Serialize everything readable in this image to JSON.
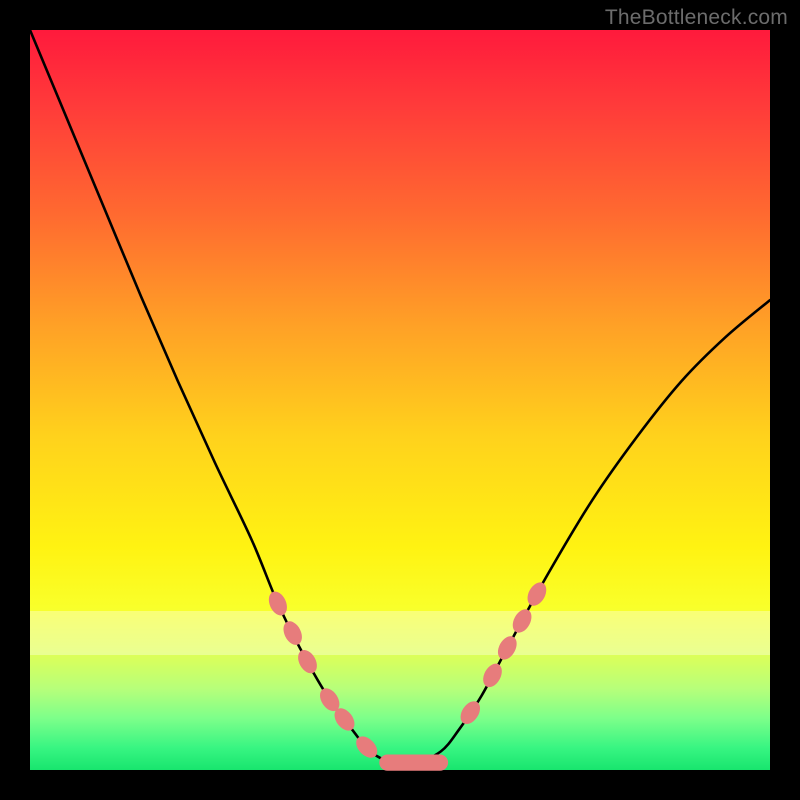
{
  "watermark": "TheBottleneck.com",
  "chart_data": {
    "type": "line",
    "title": "",
    "xlabel": "",
    "ylabel": "",
    "xlim": [
      0,
      1
    ],
    "ylim": [
      0,
      1
    ],
    "series": [
      {
        "name": "curve",
        "x": [
          0.0,
          0.05,
          0.1,
          0.15,
          0.2,
          0.25,
          0.3,
          0.335,
          0.37,
          0.405,
          0.435,
          0.46,
          0.49,
          0.52,
          0.555,
          0.58,
          0.61,
          0.645,
          0.7,
          0.76,
          0.82,
          0.88,
          0.94,
          1.0
        ],
        "y": [
          1.0,
          0.88,
          0.76,
          0.64,
          0.525,
          0.415,
          0.31,
          0.225,
          0.155,
          0.095,
          0.055,
          0.025,
          0.01,
          0.01,
          0.025,
          0.055,
          0.1,
          0.165,
          0.265,
          0.365,
          0.45,
          0.525,
          0.585,
          0.635
        ]
      }
    ],
    "markers": {
      "note": "salmon oval markers along curve, both descending and ascending limbs; trough is one long oval",
      "color": "#e77c7c",
      "left_limb": [
        0.335,
        0.355,
        0.375,
        0.405,
        0.425,
        0.455
      ],
      "trough": {
        "x_from": 0.472,
        "x_to": 0.565
      },
      "right_limb": [
        0.595,
        0.625,
        0.645,
        0.665,
        0.685
      ]
    },
    "background": {
      "type": "vertical-gradient",
      "stops": [
        {
          "pos": 0.0,
          "color": "#ff1a3c"
        },
        {
          "pos": 0.25,
          "color": "#ff6a30"
        },
        {
          "pos": 0.55,
          "color": "#ffd21c"
        },
        {
          "pos": 0.78,
          "color": "#f9ff2a"
        },
        {
          "pos": 0.93,
          "color": "#7dff8a"
        },
        {
          "pos": 1.0,
          "color": "#18e56e"
        }
      ],
      "highlight_band_y": [
        0.785,
        0.845
      ]
    }
  }
}
